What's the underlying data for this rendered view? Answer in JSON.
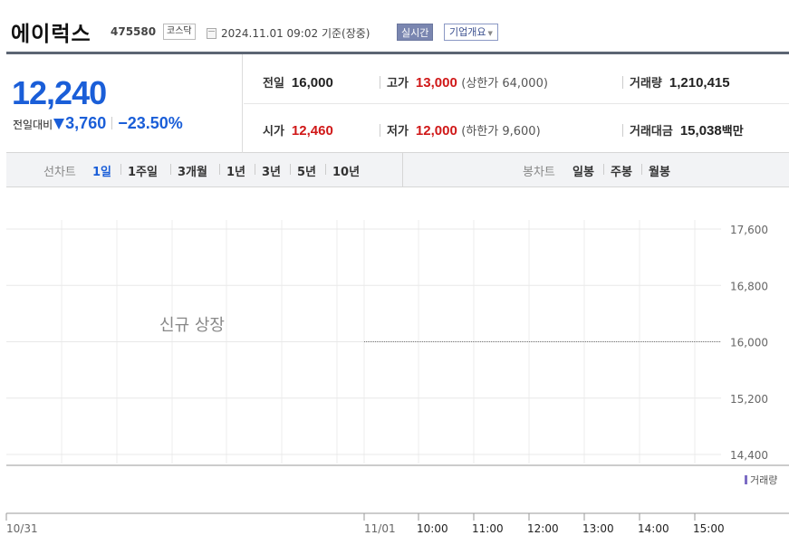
{
  "header": {
    "stock_name": "에이럭스",
    "stock_code": "475580",
    "market": "코스닥",
    "timestamp": "2024.11.01 09:02",
    "timestamp_suffix": "기준(장중)",
    "realtime_button": "실시간",
    "company_button": "기업개요"
  },
  "summary": {
    "current_price": "12,240",
    "diff_label": "전일대비",
    "diff_value": "3,760",
    "diff_rate": "−23.50%",
    "diff_color": "#1a5ed8",
    "prev_close_label": "전일",
    "prev_close": "16,000",
    "high_label": "고가",
    "high": "13,000",
    "upper_limit": "(상한가 64,000)",
    "volume_label": "거래량",
    "volume": "1,210,415",
    "open_label": "시가",
    "open": "12,460",
    "low_label": "저가",
    "low": "12,000",
    "lower_limit": "(하한가 9,600)",
    "amount_label": "거래대금",
    "amount": "15,038",
    "amount_unit": "백만",
    "up_color": "#d01818"
  },
  "tabs": {
    "line_label": "선차트",
    "line_tabs": [
      "1일",
      "1주일",
      "3개월",
      "1년",
      "3년",
      "5년",
      "10년"
    ],
    "active_line_tab": "1일",
    "candle_label": "봉차트",
    "candle_tabs": [
      "일봉",
      "주봉",
      "월봉"
    ]
  },
  "chart_data": {
    "type": "line",
    "annotation": "신규 상장",
    "y_ticks": [
      "17,600",
      "16,800",
      "16,000",
      "15,200",
      "14,400"
    ],
    "ylim": [
      14400,
      17600
    ],
    "x_ticks": [
      "10/31",
      "11/01",
      "10:00",
      "11:00",
      "12:00",
      "13:00",
      "14:00",
      "15:00"
    ],
    "series": [
      {
        "x": [
          "11/01",
          "15:30"
        ],
        "values": [
          16000,
          16000
        ]
      }
    ],
    "volume_legend": "거래량",
    "grid": true
  }
}
